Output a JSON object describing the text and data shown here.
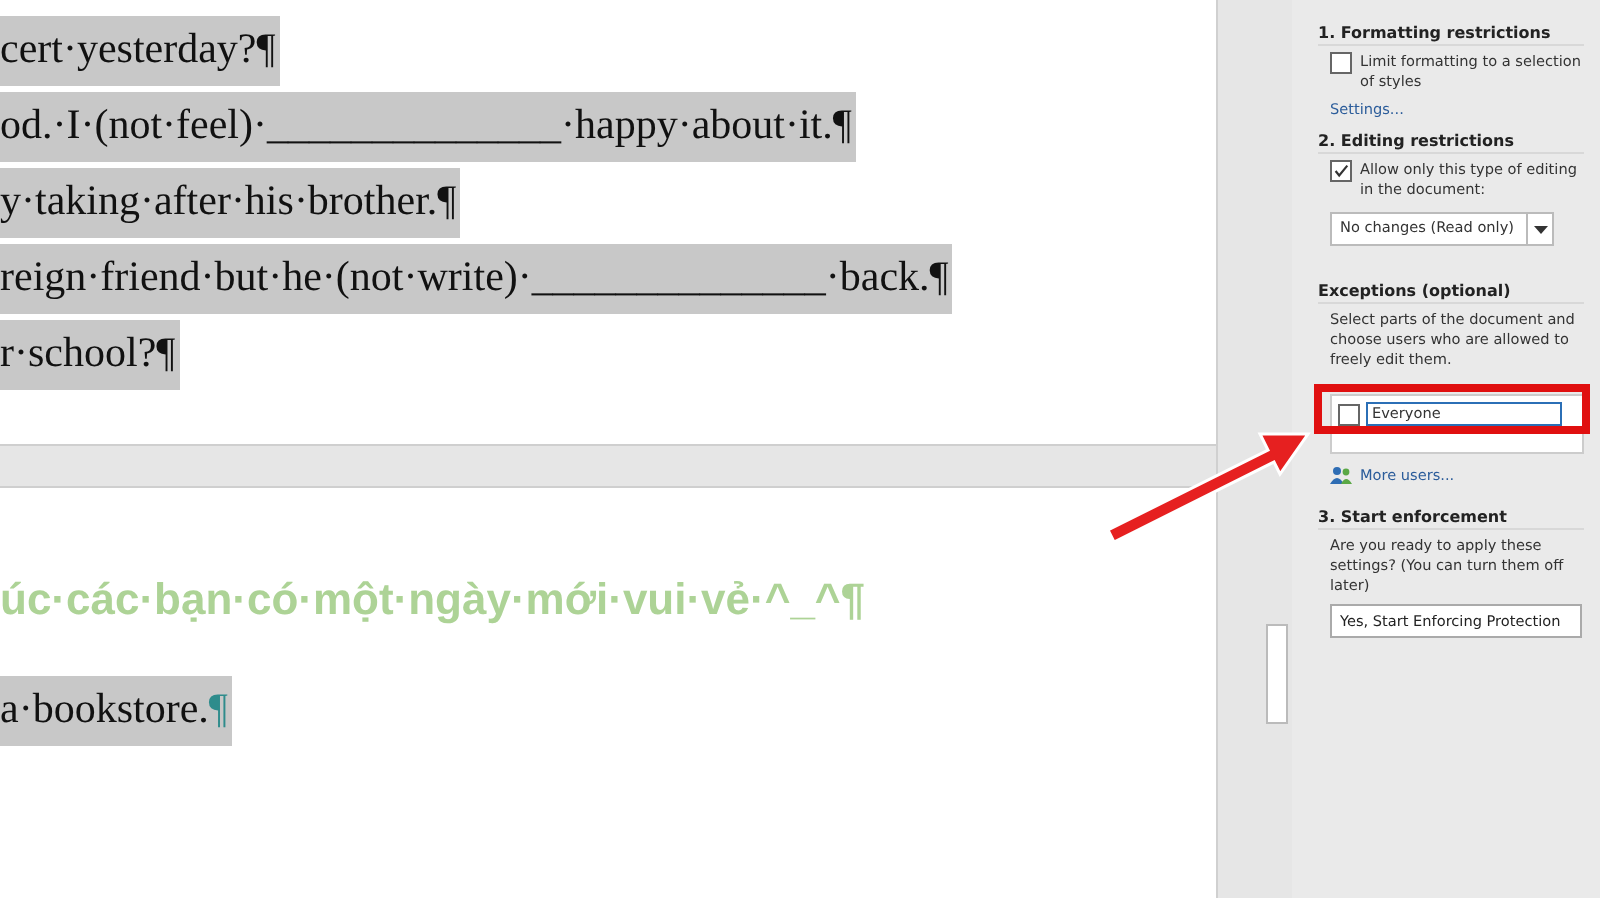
{
  "document": {
    "pages": [
      {
        "lines": [
          {
            "kind": "text",
            "text": "cert·yesterday?¶",
            "highlighted": true
          },
          {
            "kind": "text",
            "text": "od.·I·(not·feel)·______________·happy·about·it.¶",
            "highlighted": true
          },
          {
            "kind": "text",
            "text": "y·taking·after·his·brother.¶",
            "highlighted": true
          },
          {
            "kind": "text",
            "text": "reign·friend·but·he·(not·write)·______________·back.¶",
            "highlighted": true
          },
          {
            "kind": "text",
            "text": "r·school?¶",
            "highlighted": true
          }
        ]
      },
      {
        "lines": [
          {
            "kind": "heading",
            "text": "úc·các·bạn·có·một·ngày·mới·vui·vẻ·^_^¶",
            "highlighted": false
          },
          {
            "kind": "marked",
            "text": "a·bookstore.",
            "pilcrow": "¶",
            "highlighted": true
          }
        ]
      }
    ]
  },
  "panel": {
    "formatting": {
      "heading": "1. Formatting restrictions",
      "checkbox": {
        "label": "Limit formatting to a selection of styles",
        "checked": false
      },
      "link": "Settings..."
    },
    "editing": {
      "heading": "2. Editing restrictions",
      "checkbox": {
        "label": "Allow only this type of editing in the document:",
        "checked": true
      },
      "dropdown": {
        "value": "No changes (Read only)"
      }
    },
    "exceptions": {
      "heading": "Exceptions (optional)",
      "description": "Select parts of the document and choose users who are allowed to freely edit them.",
      "groups": [
        {
          "name": "Everyone",
          "checked": false
        }
      ],
      "more_users": "More users..."
    },
    "enforcement": {
      "heading": "3. Start enforcement",
      "description": "Are you ready to apply these settings? (You can turn them off later)",
      "button": "Yes, Start Enforcing Protection"
    }
  }
}
